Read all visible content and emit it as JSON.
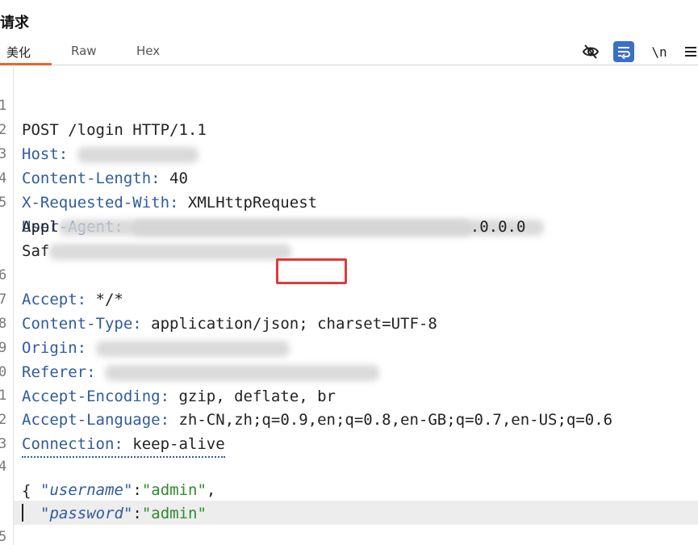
{
  "panel": {
    "title": "请求"
  },
  "tabs": [
    {
      "label": "美化",
      "active": true
    },
    {
      "label": "Raw",
      "active": false
    },
    {
      "label": "Hex",
      "active": false
    }
  ],
  "toolbar": {
    "hide_icon": "eye-slash-icon",
    "wrap_icon": "text-wrap-icon",
    "newline_label": "\\n",
    "menu_icon": "menu-icon"
  },
  "lines": {
    "l1": {
      "num": "1",
      "text": "POST /login HTTP/1.1"
    },
    "l2": {
      "num": "2",
      "name": "Host",
      "sep": ": "
    },
    "l3": {
      "num": "3",
      "name": "Content-Length",
      "sep": ": ",
      "value": "40"
    },
    "l4": {
      "num": "4",
      "name": "X-Requested-With",
      "sep": ": ",
      "value": "XMLHttpRequest"
    },
    "l5": {
      "num": "5",
      "name": "User-Agent",
      "sep": ": "
    },
    "l5b": {
      "text": "Appl",
      "tail": ".0.0.0"
    },
    "l5c": {
      "text": "Saf"
    },
    "l6": {
      "num": "6",
      "name": "Accept",
      "sep": ": ",
      "value": "*/*"
    },
    "l7": {
      "num": "7",
      "name": "Content-Type",
      "sep": ": ",
      "value": "application/json; charset=UTF-8"
    },
    "l8": {
      "num": "8",
      "name": "Origin",
      "sep": ": "
    },
    "l9": {
      "num": "9",
      "name": "Referer",
      "sep": ": "
    },
    "l10": {
      "num": "0",
      "name": "Accept-Encoding",
      "sep": ": ",
      "value": "gzip, deflate, br"
    },
    "l11": {
      "num": "1",
      "name": "Accept-Language",
      "sep": ": ",
      "value": "zh-CN,zh;q=0.9,en;q=0.8,en-GB;q=0.7,en-US;q=0.6"
    },
    "l12": {
      "num": "2",
      "name": "Connection",
      "sep": ": ",
      "value": "keep-alive"
    },
    "l13": {
      "num": "3"
    },
    "l14": {
      "num": "4",
      "text": "{"
    },
    "l14b": {
      "key": "\"username\"",
      "colon": ":",
      "value": "\"admin\"",
      "comma": ","
    },
    "l14c": {
      "key": "\"password\"",
      "colon": ":",
      "value": "\"admin\""
    },
    "l15": {
      "num": "5"
    }
  },
  "colors": {
    "accent": "#e8662c",
    "header_name": "#2f5ba0",
    "json_value": "#2e8b2e",
    "highlight_box": "#e03a3a",
    "tool_active": "#3b6fc4"
  }
}
